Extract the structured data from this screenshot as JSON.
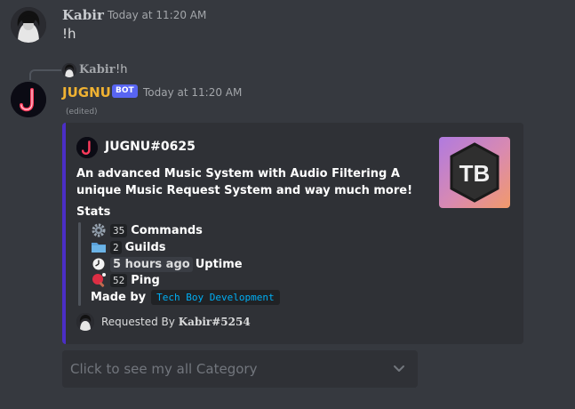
{
  "messages": {
    "user": {
      "name": "Kabir",
      "timestamp": "Today at 11:20 AM",
      "content": "!h"
    },
    "reply_ref": {
      "name": "Kabir",
      "content": "!h"
    },
    "bot": {
      "name": "JUGNU",
      "tag": "BOT",
      "timestamp": "Today at 11:20 AM",
      "edited": "(edited)",
      "name_color": "#f0b232"
    }
  },
  "embed": {
    "accent_color": "#4b2ec6",
    "author": "JUGNU#0625",
    "thumbnail_text": "TB",
    "description": "An advanced Music System with Audio Filtering A unique Music Request System and way much more!",
    "field_name": "Stats",
    "stats": [
      {
        "icon": "gear-icon",
        "value": "35",
        "label": "Commands"
      },
      {
        "icon": "folder-icon",
        "value": "2",
        "label": "Guilds"
      },
      {
        "icon": "clock-icon",
        "value": "5 hours ago",
        "label": "Uptime"
      },
      {
        "icon": "ping-pong-icon",
        "value": "52",
        "label": "Ping"
      }
    ],
    "made_by_label": "Made by",
    "made_by_link": "Tech Boy Development",
    "footer_prefix": "Requested By",
    "footer_user": "Kabir#5254"
  },
  "select_menu": {
    "placeholder": "Click to see my all Category"
  }
}
